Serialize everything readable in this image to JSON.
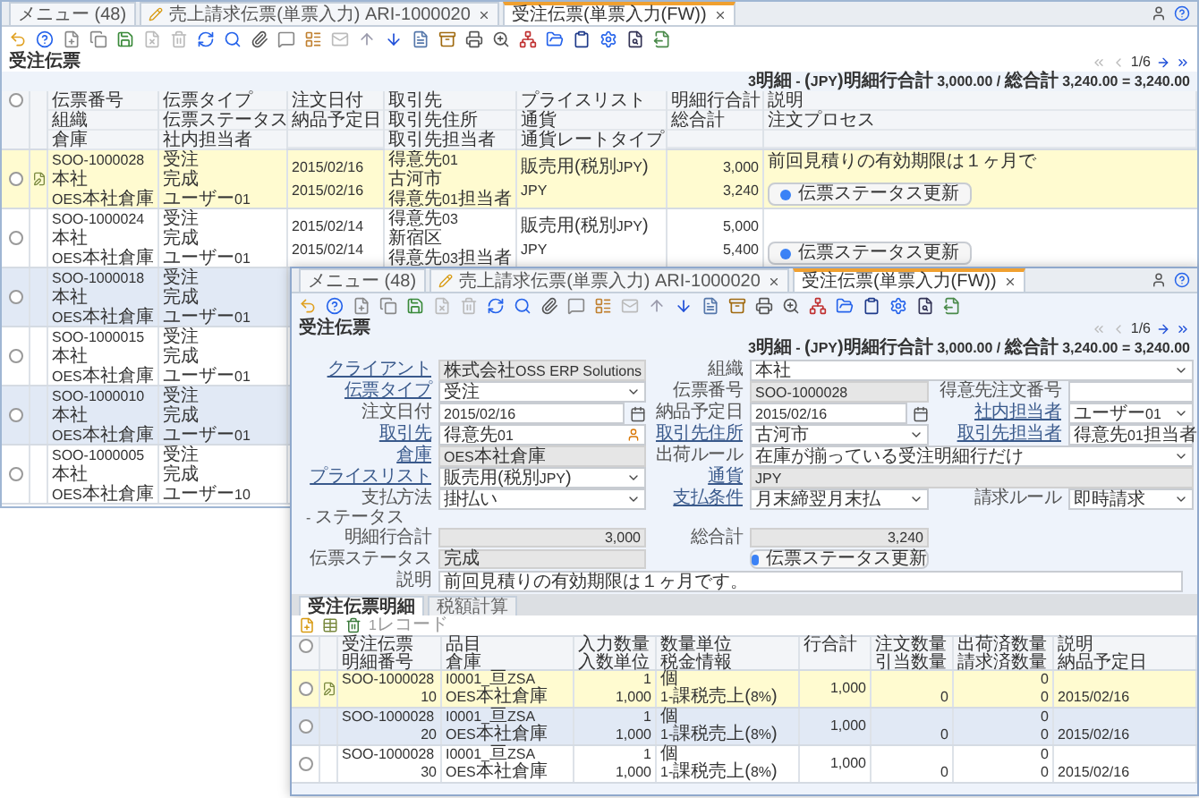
{
  "back_window": {
    "tabs": [
      {
        "label": "メニュー (48)",
        "kind": "menu",
        "selected": false
      },
      {
        "label": "売上請求伝票(単票入力) ARI-1000020",
        "kind": "document",
        "selected": false
      },
      {
        "label": "受注伝票(単票入力(FW))",
        "kind": "window",
        "selected": true
      }
    ],
    "title": "受注伝票",
    "pager": "1/6",
    "summary": "3明細 - (JPY)明細行合計 3,000.00 / 総合計 3,240.00 = 3,240.00",
    "all_checked": false,
    "columns": [
      {
        "lines": [
          "伝票番号",
          "組織",
          "倉庫"
        ]
      },
      {
        "lines": [
          "伝票タイプ",
          "伝票ステータス",
          "社内担当者"
        ]
      },
      {
        "lines": [
          "注文日付",
          "納品予定日"
        ]
      },
      {
        "lines": [
          "取引先",
          "取引先住所",
          "取引先担当者"
        ]
      },
      {
        "lines": [
          "プライスリスト",
          "通貨",
          "通貨レートタイプ"
        ]
      },
      {
        "lines": [
          "明細行合計",
          "総合計"
        ]
      },
      {
        "lines": [
          "説明",
          "注文プロセス"
        ]
      }
    ],
    "records": [
      {
        "selected": true,
        "checked": false,
        "cells": [
          [
            "SOO-1000028",
            "本社",
            "OES本社倉庫"
          ],
          [
            "受注",
            "完成",
            "ユーザー01"
          ],
          [
            "2015/02/16",
            "2015/02/16"
          ],
          [
            "得意先01",
            "古河市",
            "得意先01担当者"
          ],
          [
            "販売用(税別JPY)",
            "JPY"
          ],
          [
            "3,000",
            "3,240"
          ]
        ],
        "note": "前回見積りの有効期限は１ヶ月で",
        "button": "伝票ステータス更新"
      },
      {
        "selected": false,
        "checked": false,
        "cells": [
          [
            "SOO-1000024",
            "本社",
            "OES本社倉庫"
          ],
          [
            "受注",
            "完成",
            "ユーザー01"
          ],
          [
            "2015/02/14",
            "2015/02/14"
          ],
          [
            "得意先03",
            "新宿区",
            "得意先03担当者"
          ],
          [
            "販売用(税別JPY)",
            "JPY"
          ],
          [
            "5,000",
            "5,400"
          ]
        ],
        "button": "伝票ステータス更新"
      },
      {
        "selected": false,
        "checked": false,
        "cells": [
          [
            "SOO-1000018",
            "本社",
            "OES本社倉庫"
          ],
          [
            "受注",
            "完成",
            "ユーザー01"
          ]
        ]
      },
      {
        "selected": false,
        "checked": false,
        "cells": [
          [
            "SOO-1000015",
            "本社",
            "OES本社倉庫"
          ],
          [
            "受注",
            "完成",
            "ユーザー01"
          ]
        ]
      },
      {
        "selected": false,
        "checked": false,
        "cells": [
          [
            "SOO-1000010",
            "本社",
            "OES本社倉庫"
          ],
          [
            "受注",
            "完成",
            "ユーザー01"
          ]
        ]
      },
      {
        "selected": false,
        "checked": false,
        "cells": [
          [
            "SOO-1000005",
            "本社",
            "OES本社倉庫"
          ],
          [
            "受注",
            "完成",
            "ユーザー10"
          ]
        ]
      }
    ]
  },
  "front_window": {
    "tabs": [
      {
        "label": "メニュー (48)",
        "kind": "menu",
        "selected": false
      },
      {
        "label": "売上請求伝票(単票入力) ARI-1000020",
        "kind": "document",
        "selected": false
      },
      {
        "label": "受注伝票(単票入力(FW))",
        "kind": "window",
        "selected": true
      }
    ],
    "title": "受注伝票",
    "pager": "1/6",
    "summary": "3明細 - (JPY)明細行合計 3,000.00 / 総合計 3,240.00 = 3,240.00",
    "form": [
      [
        {
          "label": "クライアント",
          "value": "株式会社OSS ERP Solutions",
          "kind": "readonly",
          "link": true
        },
        {
          "label": "組織",
          "value": "本社",
          "kind": "select",
          "link": false
        }
      ],
      [
        {
          "label": "伝票タイプ",
          "value": "受注",
          "kind": "select",
          "link": true
        },
        {
          "label": "伝票番号",
          "value": "SOO-1000028",
          "kind": "readonly",
          "link": false
        },
        {
          "label": "得意先注文番号",
          "kind": "text",
          "link": false
        }
      ],
      [
        {
          "label": "注文日付",
          "value": "2015/02/16",
          "kind": "date",
          "link": false
        },
        {
          "label": "納品予定日",
          "value": "2015/02/16",
          "kind": "date",
          "link": false
        },
        {
          "label": "社内担当者",
          "value": "ユーザー01",
          "kind": "select",
          "link": true
        }
      ],
      [
        {
          "label": "取引先",
          "value": "得意先01",
          "kind": "search",
          "link": true
        },
        {
          "label": "取引先住所",
          "value": "古河市",
          "kind": "select",
          "link": true
        },
        {
          "label": "取引先担当者",
          "value": "得意先01担当者",
          "kind": "select",
          "link": true
        }
      ],
      [
        {
          "label": "倉庫",
          "value": "OES本社倉庫",
          "kind": "readonly",
          "link": true
        },
        {
          "label": "出荷ルール",
          "value": "在庫が揃っている受注明細行だけ",
          "kind": "select",
          "link": false
        }
      ],
      [
        {
          "label": "プライスリスト",
          "value": "販売用(税別JPY)",
          "kind": "select",
          "link": true
        },
        {
          "label": "通貨",
          "value": "JPY",
          "kind": "readonly",
          "link": true
        }
      ],
      [
        {
          "label": "支払方法",
          "value": "掛払い",
          "kind": "select",
          "link": false
        },
        {
          "label": "支払条件",
          "value": "月末締翌月末払",
          "kind": "select",
          "link": true
        },
        {
          "label": "請求ルール",
          "value": "即時請求",
          "kind": "select",
          "link": false
        }
      ]
    ],
    "status_header": "- ステータス",
    "status": {
      "line_total": {
        "label": "明細行合計",
        "value": "3,000"
      },
      "grand_total": {
        "label": "総合計",
        "value": "3,240"
      },
      "doc_status": {
        "label": "伝票ステータス",
        "value": "完成"
      },
      "button": "伝票ステータス更新",
      "description": {
        "label": "説明",
        "value": "前回見積りの有効期限は１ヶ月です。"
      }
    },
    "detail_tabs": [
      {
        "label": "受注伝票明細",
        "selected": true
      },
      {
        "label": "税額計算",
        "selected": false
      }
    ],
    "record_count": "1レコード",
    "all_checked": false,
    "detail_columns": [
      {
        "lines": [
          "受注伝票",
          "明細番号"
        ]
      },
      {
        "lines": [
          "品目",
          "倉庫"
        ]
      },
      {
        "lines": [
          "入力数量",
          "入数単位"
        ]
      },
      {
        "lines": [
          "数量単位",
          "税金情報"
        ]
      },
      {
        "lines": [
          "行合計"
        ]
      },
      {
        "lines": [
          "注文数量",
          "引当数量"
        ]
      },
      {
        "lines": [
          "出荷済数量",
          "請求済数量"
        ]
      },
      {
        "lines": [
          "説明",
          "納品予定日"
        ]
      }
    ],
    "detail_rows": [
      {
        "selected": true,
        "checked": false,
        "cells": [
          [
            "SOO-1000028",
            "10"
          ],
          [
            "I0001_亘ZSA",
            "OES本社倉庫"
          ],
          [
            "1",
            "1,000"
          ],
          [
            "個",
            "1-課税売上(8%)"
          ],
          [
            "1,000"
          ],
          [
            null,
            "0"
          ],
          [
            "0",
            "0"
          ],
          [
            null,
            "2015/02/16"
          ]
        ]
      },
      {
        "selected": false,
        "checked": false,
        "cells": [
          [
            "SOO-1000028",
            "20"
          ],
          [
            "I0001_亘ZSA",
            "OES本社倉庫"
          ],
          [
            "1",
            "1,000"
          ],
          [
            "個",
            "1-課税売上(8%)"
          ],
          [
            "1,000"
          ],
          [
            null,
            "0"
          ],
          [
            "0",
            "0"
          ],
          [
            null,
            "2015/02/16"
          ]
        ]
      },
      {
        "selected": false,
        "checked": false,
        "cells": [
          [
            "SOO-1000028",
            "30"
          ],
          [
            "I0001_亘ZSA",
            "OES本社倉庫"
          ],
          [
            "1",
            "1,000"
          ],
          [
            "個",
            "1-課税売上(8%)"
          ],
          [
            "1,000"
          ],
          [
            null,
            "0"
          ],
          [
            "0",
            "0"
          ],
          [
            null,
            "2015/02/16"
          ]
        ]
      }
    ]
  }
}
